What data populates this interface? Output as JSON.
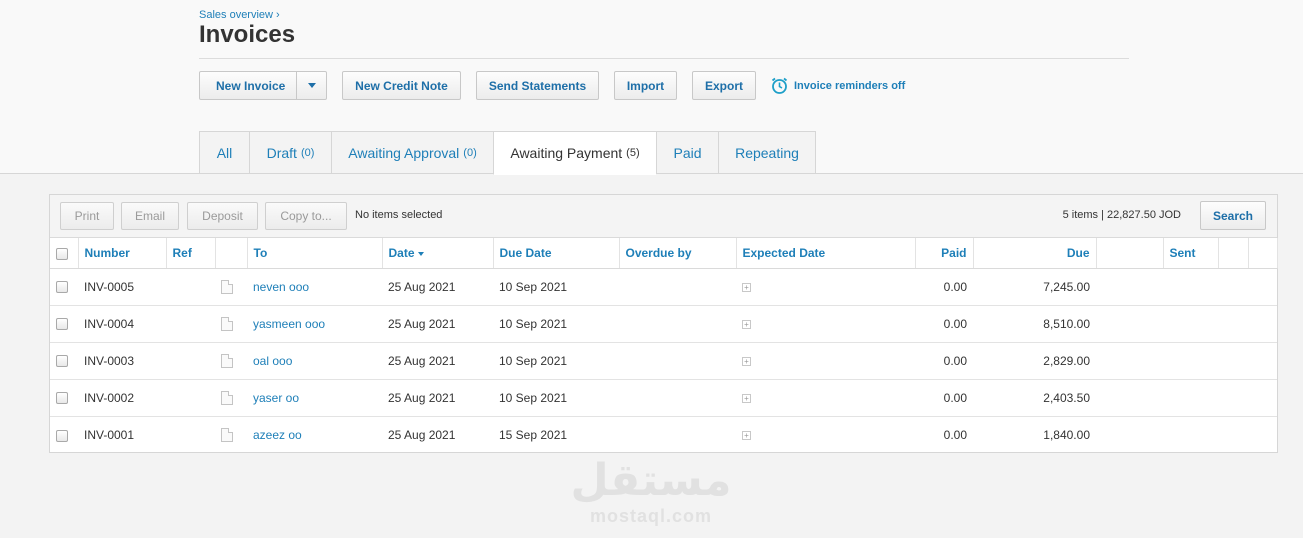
{
  "breadcrumb": "Sales overview ›",
  "title": "Invoices",
  "actions": {
    "new_invoice": "New Invoice",
    "new_credit_note": "New Credit Note",
    "send_statements": "Send Statements",
    "import": "Import",
    "export": "Export",
    "reminders": "Invoice reminders off"
  },
  "tabs": [
    {
      "label": "All",
      "count": ""
    },
    {
      "label": "Draft",
      "count": "(0)"
    },
    {
      "label": "Awaiting Approval",
      "count": "(0)"
    },
    {
      "label": "Awaiting Payment",
      "count": "(5)"
    },
    {
      "label": "Paid",
      "count": ""
    },
    {
      "label": "Repeating",
      "count": ""
    }
  ],
  "toolbar": {
    "print": "Print",
    "email": "Email",
    "deposit": "Deposit",
    "copy_to": "Copy to...",
    "selection": "No items selected",
    "summary": "5 items  | 22,827.50  JOD",
    "search": "Search"
  },
  "columns": {
    "number": "Number",
    "ref": "Ref",
    "to": "To",
    "date": "Date",
    "due_date": "Due Date",
    "overdue_by": "Overdue by",
    "expected_date": "Expected Date",
    "paid": "Paid",
    "due": "Due",
    "sent": "Sent"
  },
  "rows": [
    {
      "number": "INV-0005",
      "ref": "",
      "to": "neven ooo",
      "date": "25 Aug 2021",
      "due_date": "10 Sep 2021",
      "overdue_by": "",
      "paid": "0.00",
      "due": "7,245.00",
      "sent": ""
    },
    {
      "number": "INV-0004",
      "ref": "",
      "to": "yasmeen ooo",
      "date": "25 Aug 2021",
      "due_date": "10 Sep 2021",
      "overdue_by": "",
      "paid": "0.00",
      "due": "8,510.00",
      "sent": ""
    },
    {
      "number": "INV-0003",
      "ref": "",
      "to": "oal ooo",
      "date": "25 Aug 2021",
      "due_date": "10 Sep 2021",
      "overdue_by": "",
      "paid": "0.00",
      "due": "2,829.00",
      "sent": ""
    },
    {
      "number": "INV-0002",
      "ref": "",
      "to": "yaser oo",
      "date": "25 Aug 2021",
      "due_date": "10 Sep 2021",
      "overdue_by": "",
      "paid": "0.00",
      "due": "2,403.50",
      "sent": ""
    },
    {
      "number": "INV-0001",
      "ref": "",
      "to": "azeez oo",
      "date": "25 Aug 2021",
      "due_date": "15 Sep 2021",
      "overdue_by": "",
      "paid": "0.00",
      "due": "1,840.00",
      "sent": ""
    }
  ],
  "watermark": {
    "arabic": "مستقل",
    "latin": "mostaql.com"
  },
  "colors": {
    "link": "#1e7fb8",
    "button_text": "#1e6fa8",
    "disabled_text": "#9a9a9a"
  }
}
